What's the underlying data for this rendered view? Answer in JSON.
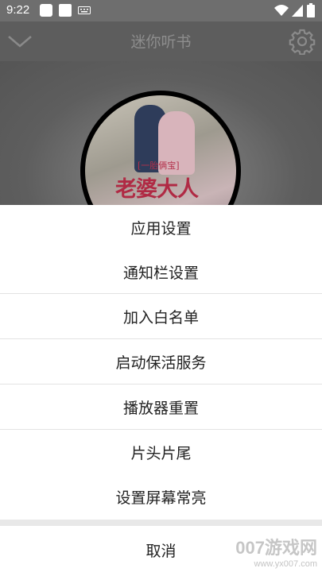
{
  "status_bar": {
    "time": "9:22",
    "icons": [
      "app-square-icon",
      "app-square-icon",
      "keyboard-icon",
      "wifi-icon",
      "signal-icon",
      "battery-icon"
    ]
  },
  "header": {
    "title": "迷你听书",
    "left_icon": "chevron-down-icon",
    "right_icon": "gear-icon"
  },
  "cover": {
    "tag": "[一胎俩宝]",
    "title": "老婆大人"
  },
  "menu": {
    "items": [
      "应用设置",
      "通知栏设置",
      "加入白名单",
      "启动保活服务",
      "播放器重置",
      "片头片尾",
      "设置屏幕常亮"
    ],
    "cancel": "取消"
  },
  "watermark": {
    "brand": "007游戏网",
    "url": "www.yx007.com"
  },
  "colors": {
    "overlay": "#6a6a6a",
    "sheet": "#ffffff",
    "text": "#222222",
    "divider": "#e3e3e3"
  }
}
